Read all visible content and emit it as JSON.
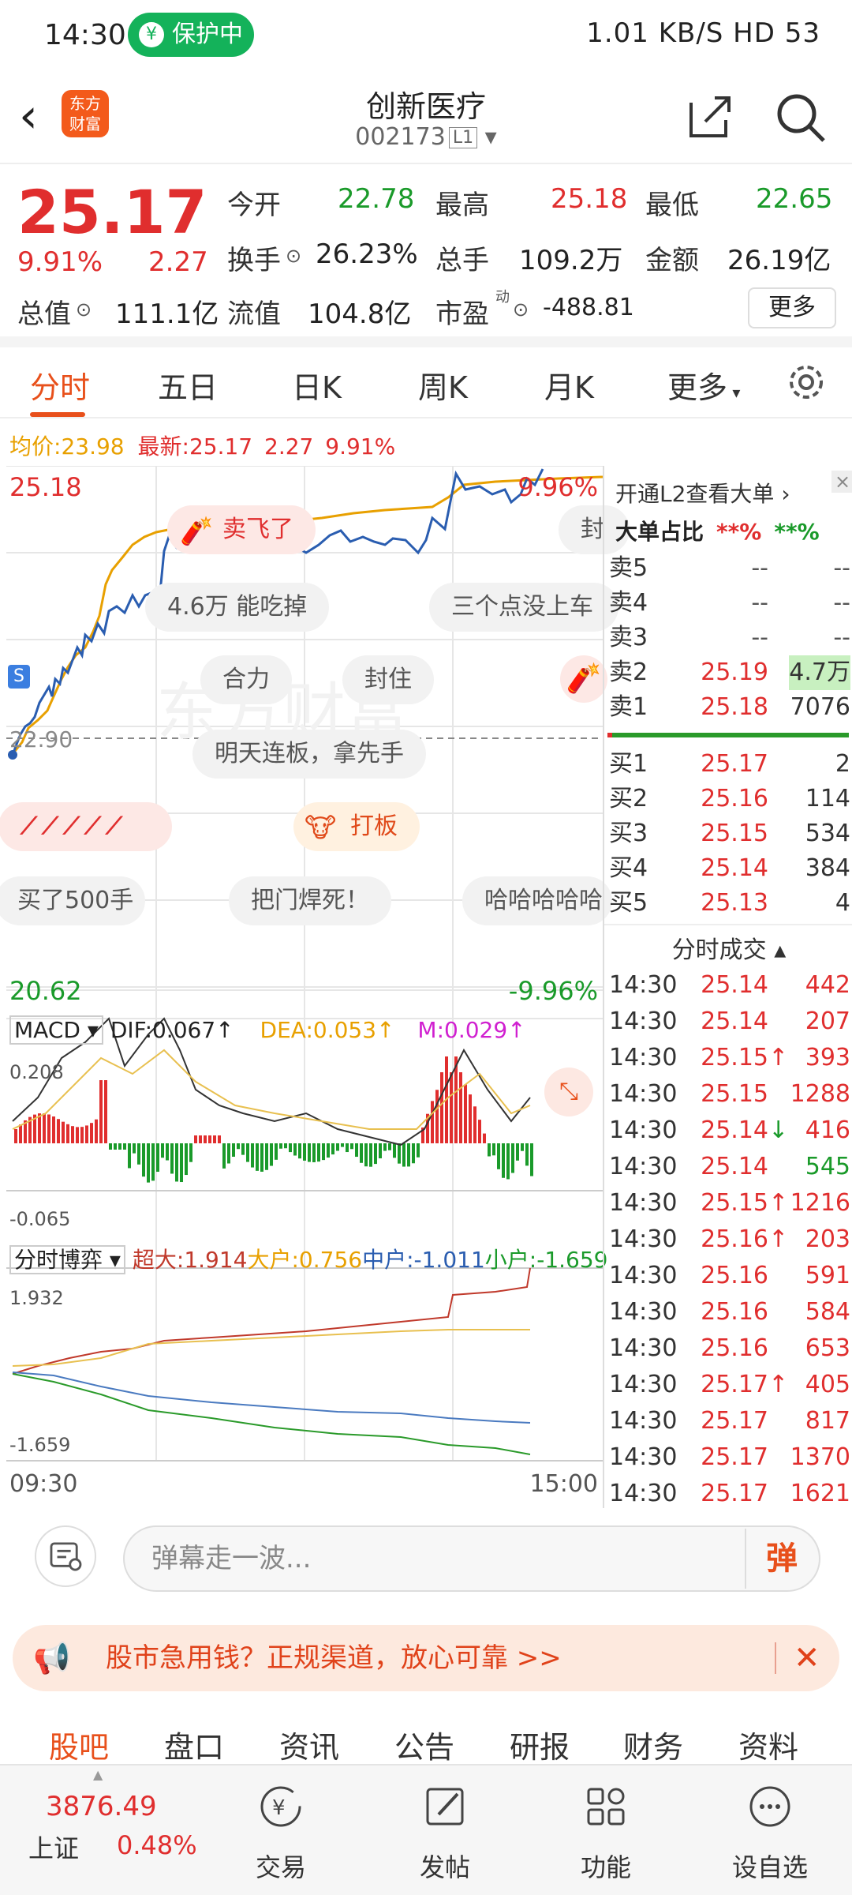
{
  "status_bar": {
    "time": "14:30",
    "protect": "保护中",
    "right": "1.01 KB/S  HD  53"
  },
  "nav": {
    "logo_line1": "东方",
    "logo_line2": "财富",
    "title": "创新医疗",
    "code": "002173",
    "level": "L1"
  },
  "quote": {
    "price": "25.17",
    "pct": "9.91%",
    "change": "2.27",
    "open_label": "今开",
    "open": "22.78",
    "high_label": "最高",
    "high": "25.18",
    "low_label": "最低",
    "low": "22.65",
    "turnover_label": "换手",
    "turnover": "26.23%",
    "volume_label": "总手",
    "volume": "109.2万",
    "amount_label": "金额",
    "amount": "26.19亿",
    "cap_label": "总值",
    "cap": "111.1亿",
    "float_label": "流值",
    "float": "104.8亿",
    "pe_label": "市盈",
    "pe_sup": "动",
    "pe": "-488.81",
    "more": "更多"
  },
  "tabs": [
    "分时",
    "五日",
    "日K",
    "周K",
    "月K",
    "更多"
  ],
  "avg_line": {
    "avg_label": "均价:",
    "avg": "23.98",
    "latest_label": "最新:",
    "latest": "25.17",
    "chg": "2.27",
    "pct": "9.91%"
  },
  "chart": {
    "top_price": "25.18",
    "top_pct": "9.96%",
    "bottom_price": "20.62",
    "bottom_pct": "-9.96%",
    "mid_price": "22.90",
    "start_time": "09:30",
    "end_time": "15:00",
    "macd_label": "MACD",
    "dif": "DIF:0.067↑",
    "dea": "DEA:0.053↑",
    "m": "M:0.029↑",
    "macd_top": "0.208",
    "macd_bottom": "-0.065",
    "flow_label": "分时博弈",
    "super": "超大:1.914",
    "large": "大户:0.756",
    "mid": "中户:-1.011",
    "small": "小户:-1.659",
    "flow_top": "1.932",
    "flow_bottom": "-1.659",
    "watermark": "东方财富",
    "s_marker": "S"
  },
  "danmaku": [
    {
      "text": "卖飞了"
    },
    {
      "text": "封"
    },
    {
      "text": "4.6万 能吃掉"
    },
    {
      "text": "三个点没上车"
    },
    {
      "text": "合力"
    },
    {
      "text": "封住"
    },
    {
      "text": "明天连板，拿先手"
    },
    {
      "text": "打板"
    },
    {
      "text": "买了500手"
    },
    {
      "text": "把门焊死！"
    },
    {
      "text": "哈哈哈哈哈"
    }
  ],
  "l2": {
    "open_l2": "开通L2查看大单",
    "big_ratio": "大单占比",
    "big_r1": "**%",
    "big_r2": "**%",
    "sells": [
      {
        "label": "卖5",
        "price": "--",
        "vol": "--"
      },
      {
        "label": "卖4",
        "price": "--",
        "vol": "--"
      },
      {
        "label": "卖3",
        "price": "--",
        "vol": "--"
      },
      {
        "label": "卖2",
        "price": "25.19",
        "vol": "4.7万"
      },
      {
        "label": "卖1",
        "price": "25.18",
        "vol": "7076"
      }
    ],
    "buys": [
      {
        "label": "买1",
        "price": "25.17",
        "vol": "2"
      },
      {
        "label": "买2",
        "price": "25.16",
        "vol": "114"
      },
      {
        "label": "买3",
        "price": "25.15",
        "vol": "534"
      },
      {
        "label": "买4",
        "price": "25.14",
        "vol": "384"
      },
      {
        "label": "买5",
        "price": "25.13",
        "vol": "4"
      }
    ],
    "trades_title": "分时成交",
    "trades": [
      {
        "t": "14:30",
        "p": "25.14",
        "v": "442",
        "a": ""
      },
      {
        "t": "14:30",
        "p": "25.14",
        "v": "207",
        "a": ""
      },
      {
        "t": "14:30",
        "p": "25.15",
        "v": "393",
        "a": "↑"
      },
      {
        "t": "14:30",
        "p": "25.15",
        "v": "1288",
        "a": ""
      },
      {
        "t": "14:30",
        "p": "25.14",
        "v": "416",
        "a": "↓"
      },
      {
        "t": "14:30",
        "p": "25.14",
        "v": "545",
        "a": ""
      },
      {
        "t": "14:30",
        "p": "25.15",
        "v": "1216",
        "a": "↑"
      },
      {
        "t": "14:30",
        "p": "25.16",
        "v": "203",
        "a": "↑"
      },
      {
        "t": "14:30",
        "p": "25.16",
        "v": "591",
        "a": ""
      },
      {
        "t": "14:30",
        "p": "25.16",
        "v": "584",
        "a": ""
      },
      {
        "t": "14:30",
        "p": "25.16",
        "v": "653",
        "a": ""
      },
      {
        "t": "14:30",
        "p": "25.17",
        "v": "405",
        "a": "↑"
      },
      {
        "t": "14:30",
        "p": "25.17",
        "v": "817",
        "a": ""
      },
      {
        "t": "14:30",
        "p": "25.17",
        "v": "1370",
        "a": ""
      },
      {
        "t": "14:30",
        "p": "25.17",
        "v": "1621",
        "a": ""
      }
    ]
  },
  "comment": {
    "placeholder": "弹幕走一波...",
    "dan": "弹"
  },
  "ad": {
    "text": "股市急用钱？正规渠道，放心可靠 >>"
  },
  "subtabs": [
    "股吧",
    "盘口",
    "资讯",
    "公告",
    "研报",
    "财务",
    "资料"
  ],
  "tabbar": {
    "index_value": "3876.49",
    "index_name": "上证",
    "index_pct": "0.48%",
    "items": [
      "交易",
      "发帖",
      "功能",
      "设自选"
    ]
  },
  "colors": {
    "accent": "#e8501b",
    "up": "#e02e2e",
    "down": "#1a9a2a",
    "price_line": "#2a5db0",
    "avg_line": "#e8a000"
  }
}
